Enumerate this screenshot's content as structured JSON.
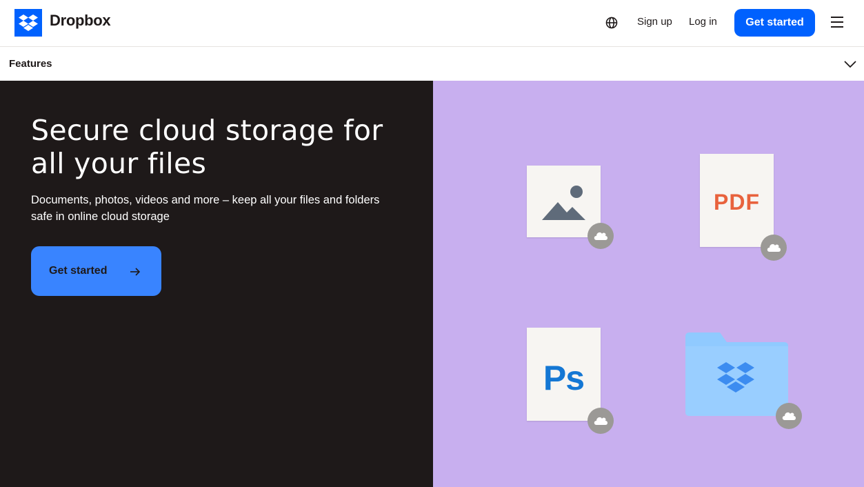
{
  "header": {
    "brand": "Dropbox",
    "signup_label": "Sign up",
    "login_label": "Log in",
    "cta_label": "Get started",
    "icons": [
      "dropbox-logo-icon",
      "globe-icon",
      "hamburger-menu-icon"
    ]
  },
  "subnav": {
    "label": "Features",
    "icon": "chevron-down-icon"
  },
  "hero": {
    "title": "Secure cloud storage for all your files",
    "subtitle": "Documents, photos, videos and more – keep all your files and folders safe in online cloud storage",
    "cta_label": "Get started",
    "cta_icon": "arrow-right-icon"
  },
  "illustration": {
    "pdf_label": "PDF",
    "ps_label": "Ps",
    "items": [
      "image-file-icon",
      "pdf-file-icon",
      "photoshop-file-icon",
      "dropbox-folder-icon"
    ],
    "badge_icon": "cloud-icon"
  },
  "colors": {
    "brand_blue": "#0061fe",
    "hero_dark": "#1e1919",
    "hero_cta": "#3984ff",
    "lavender": "#c8afef",
    "pdf_red": "#e8623d",
    "ps_blue": "#1477d4",
    "folder_blue": "#90caff"
  }
}
